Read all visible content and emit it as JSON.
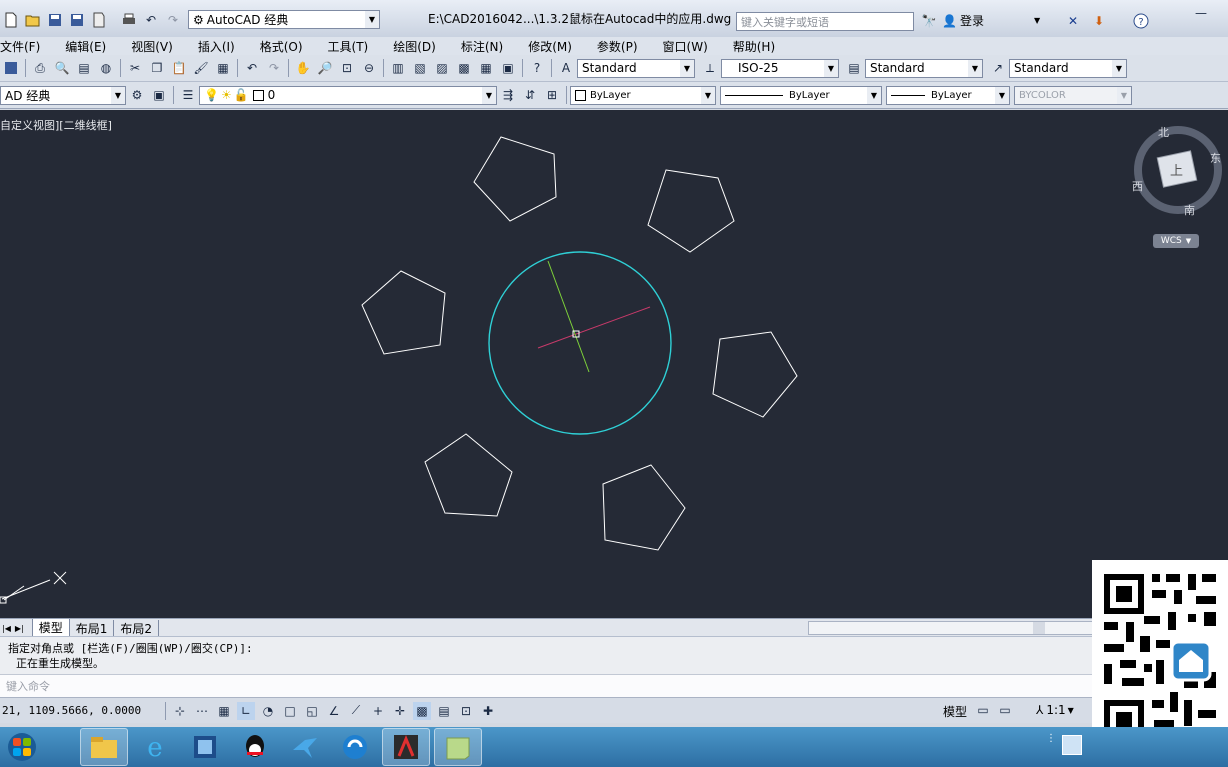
{
  "titlebar": {
    "workspace": "AutoCAD 经典",
    "file_path": "E:\\CAD2016042...\\1.3.2鼠标在Autocad中的应用.dwg",
    "search_placeholder": "键入关键字或短语",
    "login_label": "登录"
  },
  "menu": [
    "文件(F)",
    "编辑(E)",
    "视图(V)",
    "插入(I)",
    "格式(O)",
    "工具(T)",
    "绘图(D)",
    "标注(N)",
    "修改(M)",
    "参数(P)",
    "窗口(W)",
    "帮助(H)"
  ],
  "styles": {
    "text_style": "Standard",
    "dim_style": "ISO-25",
    "table_style": "Standard",
    "mleader_style": "Standard"
  },
  "layers": {
    "workspace": "AD 经典",
    "current_layer": "0",
    "color": "ByLayer",
    "linetype": "ByLayer",
    "lineweight": "ByLayer",
    "plot_style": "BYCOLOR"
  },
  "viewport": {
    "label": "自定义视图][二维线框]",
    "viewcube": {
      "top": "上",
      "north": "北",
      "south": "南",
      "east": "东",
      "west": "西",
      "wcs": "WCS"
    }
  },
  "tabs": [
    "模型",
    "布局1",
    "布局2"
  ],
  "command": {
    "line1": "指定对角点或 [栏选(F)/圈围(WP)/圈交(CP)]:",
    "line2": "正在重生成模型。",
    "placeholder": "键入命令"
  },
  "status": {
    "coords": "21, 1109.5666, 0.0000",
    "space": "模型",
    "scale": "1:1"
  },
  "colors": {
    "canvas": "#252a36",
    "circle": "#2fd0d6",
    "pentagon": "#ffffff",
    "crosshair_x": "#c83a6a",
    "crosshair_y": "#7ed23a"
  },
  "taskbar": {
    "apps": [
      "windows-logo-icon",
      "file-explorer-icon",
      "ie-icon",
      "media-icon",
      "qq-icon",
      "bird-icon",
      "sync-icon",
      "autocad-icon",
      "notes-icon"
    ]
  }
}
